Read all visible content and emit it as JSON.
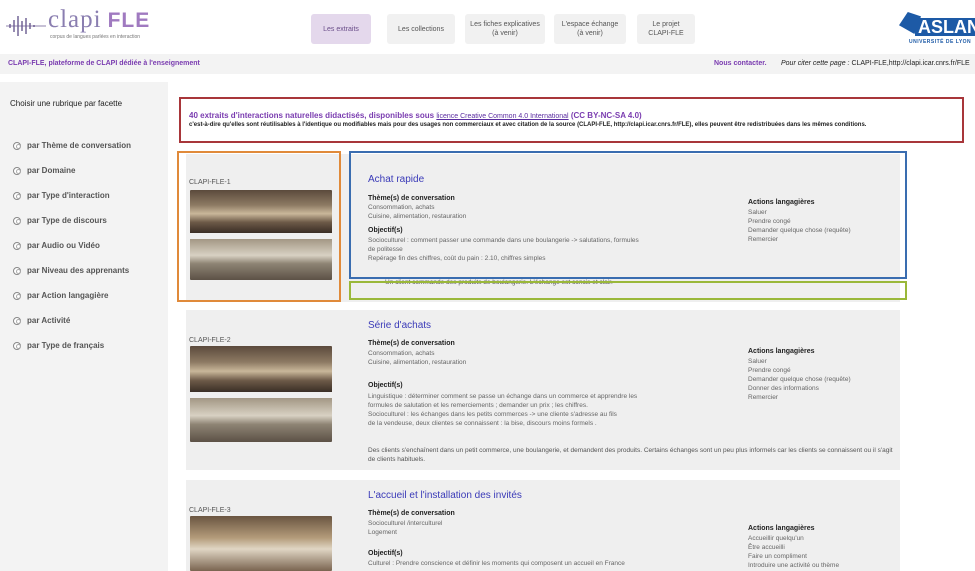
{
  "header": {
    "brand_main": "clapi",
    "brand_accent": "FLE",
    "brand_sub": "corpus de langues parlées en interaction",
    "nav": [
      {
        "line1": "Les extraits",
        "line2": ""
      },
      {
        "line1": "Les collections",
        "line2": ""
      },
      {
        "line1": "Les fiches explicatives",
        "line2": "(à venir)"
      },
      {
        "line1": "L'espace échange",
        "line2": "(à venir)"
      },
      {
        "line1": "Le projet",
        "line2": "CLAPI-FLE"
      }
    ],
    "partner_logo": "ASLAN",
    "partner_sub": "UNIVERSITÉ DE LYON"
  },
  "subheader": {
    "tagline": "CLAPI-FLE, plateforme de CLAPI dédiée à l'enseignement",
    "contact": "Nous contacter.",
    "cite_label": "Pour citer cette page :",
    "cite_value": "CLAPI-FLE,http://clapi.icar.cnrs.fr/FLE"
  },
  "sidebar": {
    "title": "Choisir une rubrique par facette",
    "facets": [
      "par Thème de conversation",
      "par Domaine",
      "par Type d'interaction",
      "par Type de discours",
      "par Audio ou Vidéo",
      "par Niveau des apprenants",
      "par Action langagière",
      "par Activité",
      "par Type de français"
    ]
  },
  "notice": {
    "headline": "40 extraits d'interactions naturelles didactisés, disponibles sous",
    "license_link": "licence Creative Common 4.0 International",
    "license_code": "(CC BY-NC-SA 4.0)",
    "body": "c'est-à-dire qu'elles sont réutilisables à l'identique ou modifiables mais pour des usages non commerciaux et avec citation de la source (CLAPI-FLE, http://clapi.icar.cnrs.fr/FLE), elles peuvent être redistribuées dans les mêmes conditions."
  },
  "extracts": [
    {
      "code": "CLAPI-FLE-1",
      "title": "Achat rapide",
      "themes_label": "Thème(s) de conversation",
      "themes": [
        "Consommation, achats",
        "Cuisine, alimentation, restauration"
      ],
      "objectives_label": "Objectif(s)",
      "objectives": [
        "Socioculturel : comment passer une commande dans une boulangerie -> salutations, formules",
        "de politesse",
        "Repérage fin des chiffres, coût du pain : 2.10, chiffres simples"
      ],
      "actions_label": "Actions langagières",
      "actions": [
        "Saluer",
        "Prendre congé",
        "Demander quelque chose (requête)",
        "Remercier"
      ],
      "summary": "Un client commande des produits de boulangerie. L'échange est concis et clair."
    },
    {
      "code": "CLAPI-FLE-2",
      "title": "Série d'achats",
      "themes_label": "Thème(s) de conversation",
      "themes": [
        "Consommation, achats",
        "Cuisine, alimentation, restauration"
      ],
      "objectives_label": "Objectif(s)",
      "objectives": [
        "Linguistique : déterminer comment se passe un échange dans un commerce et apprendre les",
        "formules de salutation et les remerciements ; demander un prix ; les chiffres.",
        "Socioculturel : les échanges dans les petits commerces -> une cliente s'adresse au fils",
        "de la vendeuse, deux clientes se connaissent : la bise, discours moins formels ."
      ],
      "actions_label": "Actions langagières",
      "actions": [
        "Saluer",
        "Prendre congé",
        "Demander quelque chose (requête)",
        "Donner des informations",
        "Remercier"
      ],
      "summary": " Des clients s'enchaînent dans un petit commerce, une boulangerie, et demandent des produits. Certains échanges sont un peu plus informels car les clients se connaissent ou il s'agit de clients habituels."
    },
    {
      "code": "CLAPI-FLE-3",
      "title": "L'accueil et l'installation des invités",
      "themes_label": "Thème(s) de conversation",
      "themes": [
        "Socioculturel /interculturel",
        "Logement"
      ],
      "objectives_label": "Objectif(s)",
      "objectives": [
        "Culturel : Prendre conscience et définir les moments qui composent un accueil en France"
      ],
      "actions_label": "Actions langagières",
      "actions": [
        "Accueillir quelqu'un",
        "Être accueilli",
        "Faire un compliment",
        "Introduire une activité ou thème"
      ]
    }
  ],
  "colors": {
    "accent_purple": "#7a3cb0",
    "title_blue": "#3a3ab8",
    "notice_border": "#a8363a",
    "thumb_highlight": "#e08a3a",
    "info_highlight": "#3a6db0",
    "summary_highlight": "#9ab83a"
  }
}
